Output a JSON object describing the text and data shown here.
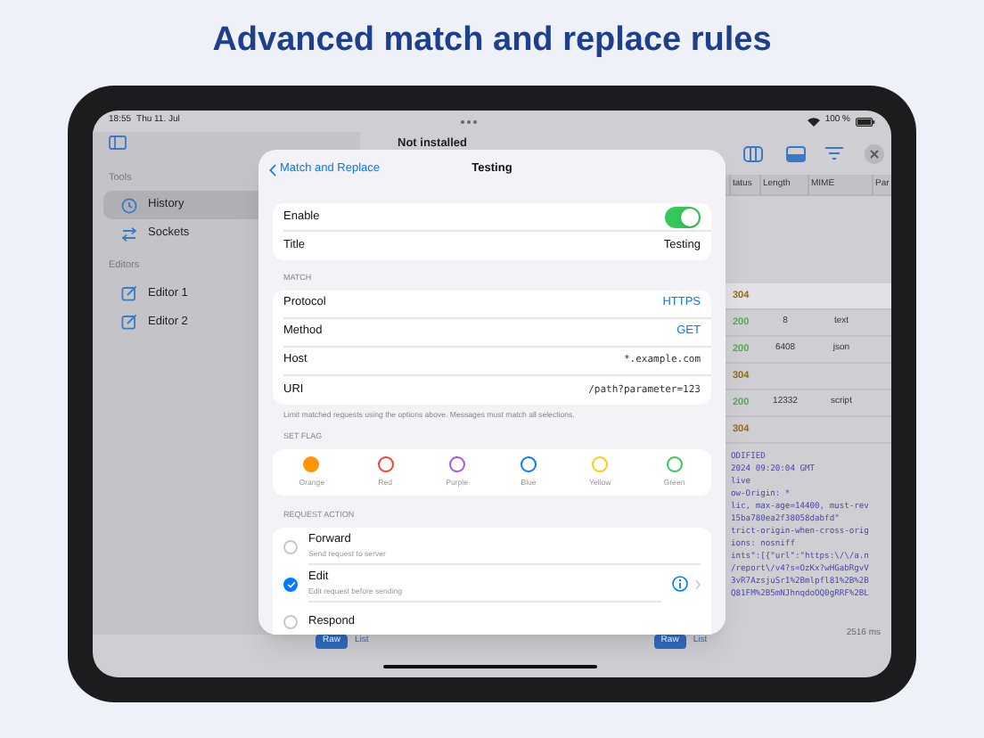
{
  "headline": "Advanced match and replace rules",
  "status_bar": {
    "time": "18:55",
    "date": "Thu 11. Jul",
    "battery": "100 %"
  },
  "sidebar": {
    "sections": [
      {
        "title": "Tools",
        "items": [
          {
            "label": "History",
            "kind": "history",
            "selected": true
          },
          {
            "label": "Sockets",
            "kind": "sockets",
            "selected": false
          }
        ]
      },
      {
        "title": "Editors",
        "items": [
          {
            "label": "Editor 1",
            "kind": "editor",
            "selected": false
          },
          {
            "label": "Editor 2",
            "kind": "editor",
            "selected": false
          }
        ]
      }
    ]
  },
  "toolbar": {
    "status": "Not installed"
  },
  "table": {
    "columns": [
      "tatus",
      "Length",
      "MIME",
      "Par"
    ],
    "rows": [
      {
        "status": "304",
        "color": "#8f6d0c",
        "selected": true
      },
      {
        "status": "200",
        "color": "#4caf50",
        "length": "8",
        "mime": "text",
        "selected": false
      },
      {
        "status": "200",
        "color": "#4caf50",
        "length": "6408",
        "mime": "json",
        "selected": false
      },
      {
        "status": "304",
        "color": "#8f6d0c",
        "selected": false
      },
      {
        "status": "200",
        "color": "#4caf50",
        "length": "12332",
        "mime": "script",
        "selected": false
      },
      {
        "status": "304",
        "color": "#8f6d0c",
        "selected": false
      }
    ]
  },
  "detail_lines": [
    "ODIFIED",
    "2024 09:20:04 GMT",
    "live",
    "ow-Origin: *",
    "lic, max-age=14400, must-rev",
    "15ba780ea2f38058dabfd\"",
    "trict-origin-when-cross-orig",
    "ions: nosniff",
    "ints\":[{\"url\":\"https:\\/\\/a.n",
    "/report\\/v4?s=OzKx?wHGabRgvV",
    "3vR7AzsjuSr1%2Bmlpfl81%2B%2B",
    "Q81FM%2B5mNJhnqdoOQ0gRRF%2BL"
  ],
  "duration": "2516 ms",
  "bottom_bar": [
    {
      "label": "Raw",
      "selected": true
    },
    {
      "label": "List",
      "selected": false
    },
    {
      "label": "Raw",
      "selected": true
    },
    {
      "label": "List",
      "selected": false
    }
  ],
  "modal": {
    "back": "Match and Replace",
    "title": "Testing",
    "general": [
      {
        "kind": "toggle",
        "label": "Enable",
        "on": true
      },
      {
        "kind": "text",
        "label": "Title",
        "value": "Testing"
      }
    ],
    "match": {
      "header": "MATCH",
      "rows": [
        {
          "kind": "option",
          "label": "Protocol",
          "value": "HTTPS"
        },
        {
          "kind": "option",
          "label": "Method",
          "value": "GET"
        },
        {
          "kind": "code",
          "label": "Host",
          "value": "*.example.com"
        },
        {
          "kind": "code",
          "label": "URI",
          "value": "/path?parameter=123"
        }
      ],
      "footer": "Limit matched requests using the options above. Messages must match all selections."
    },
    "flags": {
      "header": "SET FLAG",
      "items": [
        {
          "label": "Orange",
          "color": "#ff9500",
          "selected": true
        },
        {
          "label": "Red",
          "color": "#ff3b30",
          "selected": false
        },
        {
          "label": "Purple",
          "color": "#af52de",
          "selected": false
        },
        {
          "label": "Blue",
          "color": "#007aff",
          "selected": false
        },
        {
          "label": "Yellow",
          "color": "#ffcc00",
          "selected": false
        },
        {
          "label": "Green",
          "color": "#34c759",
          "selected": false
        }
      ]
    },
    "actions": {
      "header": "REQUEST ACTION",
      "items": [
        {
          "title": "Forward",
          "subtitle": "Send request to server",
          "selected": false,
          "has_info": false
        },
        {
          "title": "Edit",
          "subtitle": "Edit request before sending",
          "selected": true,
          "has_info": true
        },
        {
          "title": "Respond",
          "selected": false,
          "has_info": false
        }
      ]
    }
  }
}
